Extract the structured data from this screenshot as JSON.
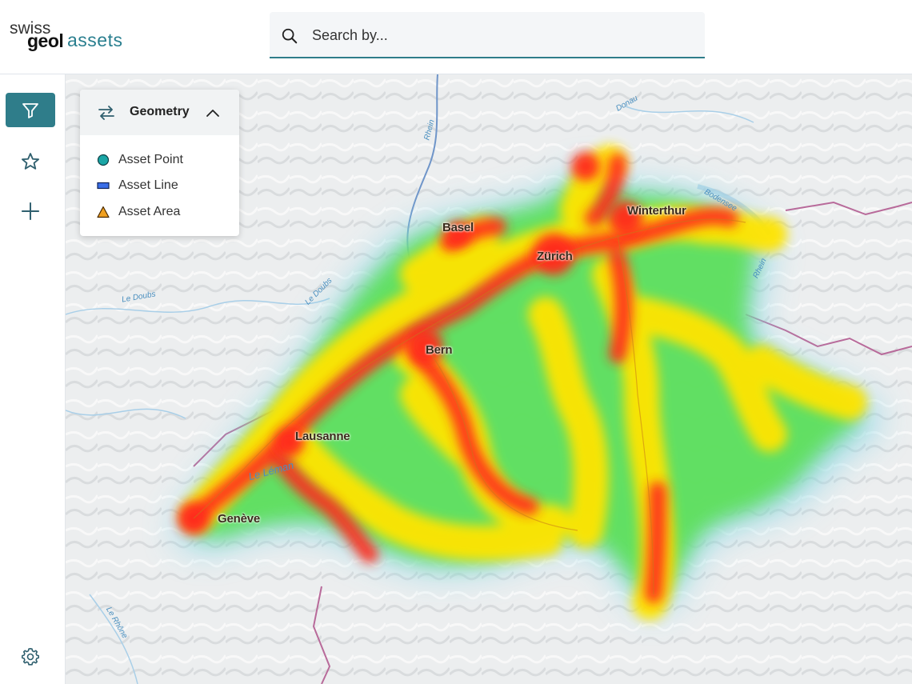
{
  "header": {
    "logo": {
      "part1": "swiss",
      "part2": "geol",
      "part3": "assets"
    },
    "search": {
      "placeholder": "Search by..."
    }
  },
  "sidebar": {
    "items": [
      {
        "name": "filter",
        "icon": "filter-icon",
        "active": true
      },
      {
        "name": "favorites",
        "icon": "star-icon",
        "active": false
      },
      {
        "name": "add",
        "icon": "plus-icon",
        "active": false
      },
      {
        "name": "settings",
        "icon": "gear-icon",
        "active": false
      }
    ]
  },
  "legend": {
    "title": "Geometry",
    "items": [
      {
        "label": "Asset Point",
        "symbol": "circle",
        "color": "#1aa6a6"
      },
      {
        "label": "Asset Line",
        "symbol": "line",
        "color": "#3a6ee8"
      },
      {
        "label": "Asset Area",
        "symbol": "triangle",
        "color": "#f0a020"
      }
    ]
  },
  "map": {
    "cities": [
      "Basel",
      "Zürich",
      "Winterthur",
      "Bern",
      "Lausanne",
      "Genève"
    ],
    "waters": [
      "Rhein",
      "Donau",
      "Bodensee",
      "Le Doubs",
      "Le Doubs",
      "Le Léman",
      "Rhein",
      "Le Rhône"
    ],
    "heat_colors": [
      "#ff2a1a",
      "#ffe400",
      "#58e05a",
      "#7fd8e8"
    ]
  }
}
